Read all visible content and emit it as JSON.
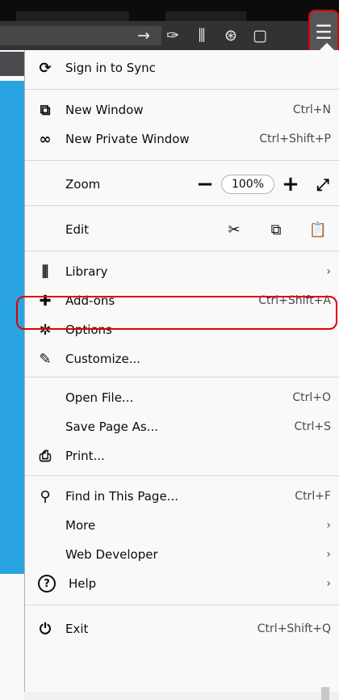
{
  "toolbar": {
    "icons": [
      "arrow-right-icon",
      "wrench-icon",
      "library-icon",
      "globe-icon",
      "sidebar-icon"
    ],
    "glyphs": [
      "→",
      "✑",
      "⫼",
      "⊛",
      "▢"
    ],
    "menu_glyph": "☰"
  },
  "menu": {
    "sign_in": {
      "label": "Sign in to Sync",
      "icon": "sync-icon",
      "glyph": "⟳"
    },
    "new_window": {
      "label": "New Window",
      "accel": "Ctrl+N",
      "icon": "new-window-icon",
      "glyph": "⧉"
    },
    "new_private": {
      "label": "New Private Window",
      "accel": "Ctrl+Shift+P",
      "icon": "private-mask-icon",
      "glyph": "∞"
    },
    "zoom": {
      "label": "Zoom",
      "minus": "−",
      "value": "100%",
      "plus": "+",
      "expand": "⤢"
    },
    "edit": {
      "label": "Edit",
      "cut": "✂",
      "copy": "⧉",
      "paste": "📋"
    },
    "library": {
      "label": "Library",
      "accel": "›",
      "icon": "library-icon",
      "glyph": "⫼"
    },
    "addons": {
      "label": "Add-ons",
      "accel": "Ctrl+Shift+A",
      "icon": "puzzle-icon",
      "glyph": "✚"
    },
    "options": {
      "label": "Options",
      "icon": "gear-icon",
      "glyph": "✲"
    },
    "customize": {
      "label": "Customize...",
      "icon": "brush-icon",
      "glyph": "✎"
    },
    "open_file": {
      "label": "Open File...",
      "accel": "Ctrl+O"
    },
    "save_page": {
      "label": "Save Page As...",
      "accel": "Ctrl+S"
    },
    "print": {
      "label": "Print...",
      "icon": "printer-icon",
      "glyph": "⎙"
    },
    "find": {
      "label": "Find in This Page...",
      "accel": "Ctrl+F",
      "icon": "search-icon",
      "glyph": "⚲"
    },
    "more": {
      "label": "More",
      "accel": "›"
    },
    "web_dev": {
      "label": "Web Developer",
      "accel": "›"
    },
    "help": {
      "label": "Help",
      "accel": "›",
      "icon": "help-icon",
      "glyph": "?"
    },
    "exit": {
      "label": "Exit",
      "accel": "Ctrl+Shift+Q",
      "icon": "power-icon",
      "glyph": "⏻"
    }
  },
  "colors": {
    "highlight": "#e00000",
    "accent": "#2aa4e0"
  }
}
